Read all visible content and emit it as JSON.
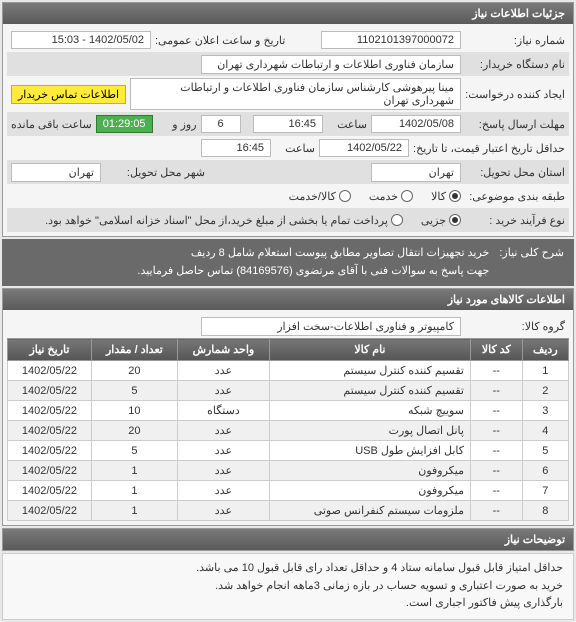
{
  "panels": {
    "details": {
      "title": "جزئیات اطلاعات نیاز"
    },
    "items": {
      "title": "اطلاعات کالاهای مورد نیاز"
    }
  },
  "labels": {
    "need_no": "شماره نیاز:",
    "announce_dt": "تاریخ و ساعت اعلان عمومی:",
    "buyer_org": "نام دستگاه خریدار:",
    "creator": "ایجاد کننده درخواست:",
    "deadline": "مهلت ارسال پاسخ:",
    "time": "ساعت",
    "day_and": "روز و",
    "remaining": "ساعت باقی مانده",
    "from_date": "حداقل تاریخ اعتبار قیمت، تا تاریخ:",
    "loc_demand": "استان محل تحویل:",
    "loc_city": "شهر محل تحویل:",
    "subject_cat": "طبقه بندی موضوعی:",
    "proc_type": "نوع فرآیند خرید :",
    "summary": "شرح کلی نیاز:",
    "goods_group": "گروه کالا:",
    "idx": "ردیف",
    "code": "کد کالا",
    "name": "نام کالا",
    "unit": "واحد شمارش",
    "qty": "تعداد / مقدار",
    "need_date": "تاریخ نیاز",
    "contact_btn": "اطلاعات تماس خریدار",
    "days_val": "6"
  },
  "values": {
    "need_no": "1102101397000072",
    "announce_dt": "1402/05/02 - 15:03",
    "buyer_org": "سازمان فناوری اطلاعات و ارتباطات شهرداری تهران",
    "creator": "مینا پیرهوشی کارشناس سازمان فناوری اطلاعات و ارتباطات شهرداری تهران",
    "deadline_date": "1402/05/08",
    "deadline_time": "16:45",
    "remaining_time": "01:29:05",
    "from_date": "1402/05/22",
    "from_time": "16:45",
    "loc_demand": "تهران",
    "loc_city": "تهران",
    "goods_group": "کامپیوتر و فناوری اطلاعات-سخت افزار"
  },
  "radios": {
    "cat": [
      {
        "label": "کالا",
        "checked": true
      },
      {
        "label": "خدمت",
        "checked": false
      },
      {
        "label": "کالا/خدمت",
        "checked": false
      }
    ],
    "proc": [
      {
        "label": "جزیی",
        "checked": true
      },
      {
        "label": "پرداخت تمام یا بخشی از مبلغ خرید،از محل \"اسناد خزانه اسلامی\" خواهد بود.",
        "checked": false
      }
    ]
  },
  "summary_lines": [
    "خرید تجهیزات انتقال تصاویر مطابق پیوست استعلام شامل 8 ردیف",
    "جهت پاسخ به سوالات فنی با آقای مرتضوی (84169576) تماس حاصل فرمایید."
  ],
  "items": [
    {
      "idx": "1",
      "code": "--",
      "name": "تقسیم کننده کنترل سیستم",
      "unit": "عدد",
      "qty": "20",
      "date": "1402/05/22"
    },
    {
      "idx": "2",
      "code": "--",
      "name": "تقسیم کننده کنترل سیستم",
      "unit": "عدد",
      "qty": "5",
      "date": "1402/05/22"
    },
    {
      "idx": "3",
      "code": "--",
      "name": "سوییچ شبکه",
      "unit": "دستگاه",
      "qty": "10",
      "date": "1402/05/22"
    },
    {
      "idx": "4",
      "code": "--",
      "name": "پانل اتصال پورت",
      "unit": "عدد",
      "qty": "20",
      "date": "1402/05/22"
    },
    {
      "idx": "5",
      "code": "--",
      "name": "کابل افزایش طول USB",
      "unit": "عدد",
      "qty": "5",
      "date": "1402/05/22"
    },
    {
      "idx": "6",
      "code": "--",
      "name": "میکروفون",
      "unit": "عدد",
      "qty": "1",
      "date": "1402/05/22"
    },
    {
      "idx": "7",
      "code": "--",
      "name": "میکروفون",
      "unit": "عدد",
      "qty": "1",
      "date": "1402/05/22"
    },
    {
      "idx": "8",
      "code": "--",
      "name": "ملزومات سیستم کنفرانس صوتی",
      "unit": "عدد",
      "qty": "1",
      "date": "1402/05/22"
    }
  ],
  "footer_notes": [
    "حداقل امتیاز قابل قبول سامانه ستاد 4 و حداقل تعداد رای قابل قبول 10 می باشد.",
    "خرید به صورت اعتباری و تسویه حساب در بازه زمانی 3ماهه انجام خواهد شد.",
    "بارگذاری پیش فاکتور اجباری است."
  ],
  "explain_title": "توضیحات نیاز"
}
